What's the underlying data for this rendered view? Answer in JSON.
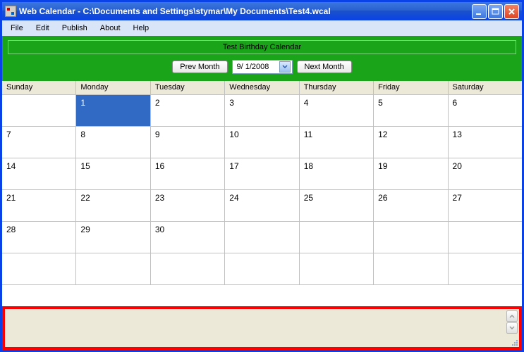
{
  "window": {
    "title": "Web Calendar   -   C:\\Documents and Settings\\stymar\\My Documents\\Test4.wcal"
  },
  "menubar": {
    "items": [
      "File",
      "Edit",
      "Publish",
      "About",
      "Help"
    ]
  },
  "toolbar": {
    "calendar_title": "Test Birthday Calendar",
    "prev_label": "Prev Month",
    "next_label": "Next Month",
    "date_value": " 9/  1/2008"
  },
  "calendar": {
    "headers": [
      "Sunday",
      "Monday",
      "Tuesday",
      "Wednesday",
      "Thursday",
      "Friday",
      "Saturday"
    ],
    "selected_day": 1,
    "rows": [
      [
        "",
        "1",
        "2",
        "3",
        "4",
        "5",
        "6"
      ],
      [
        "7",
        "8",
        "9",
        "10",
        "11",
        "12",
        "13"
      ],
      [
        "14",
        "15",
        "16",
        "17",
        "18",
        "19",
        "20"
      ],
      [
        "21",
        "22",
        "23",
        "24",
        "25",
        "26",
        "27"
      ],
      [
        "28",
        "29",
        "30",
        "",
        "",
        "",
        ""
      ],
      [
        "",
        "",
        "",
        "",
        "",
        "",
        ""
      ]
    ]
  }
}
